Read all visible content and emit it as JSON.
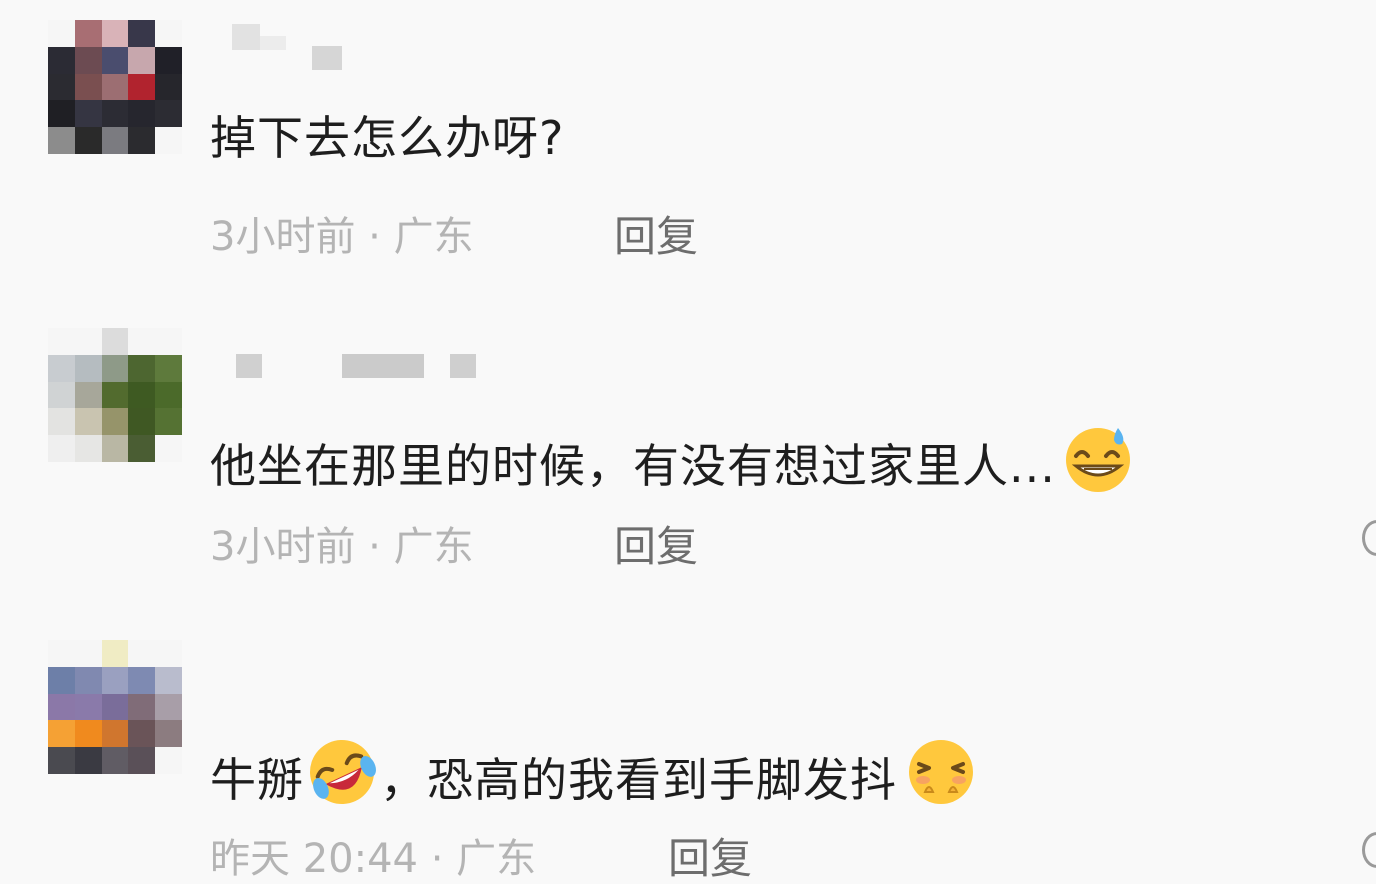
{
  "comments": [
    {
      "text": "掉下去怎么办呀?",
      "time": "3小时前",
      "location": "广东",
      "reply_label": "回复",
      "emojis": []
    },
    {
      "text": "他坐在那里的时候，有没有想过家里人...",
      "time": "3小时前",
      "location": "广东",
      "reply_label": "回复",
      "emojis": [
        "grinning-sweat-emoji"
      ]
    },
    {
      "text_before": "牛掰",
      "text_after": "，恐高的我看到手脚发抖",
      "time": "昨天 20:44",
      "location": "广东",
      "reply_label": "回复",
      "emojis": [
        "rofl-laughing-emoji",
        "persevering-emoji"
      ]
    }
  ],
  "separator": "·",
  "colors": {
    "background": "#f9f9f9",
    "text": "#1e1e1e",
    "meta": "#b4b4b4",
    "reply": "#6d6d6d",
    "emoji_yellow": "#ffc83d"
  }
}
